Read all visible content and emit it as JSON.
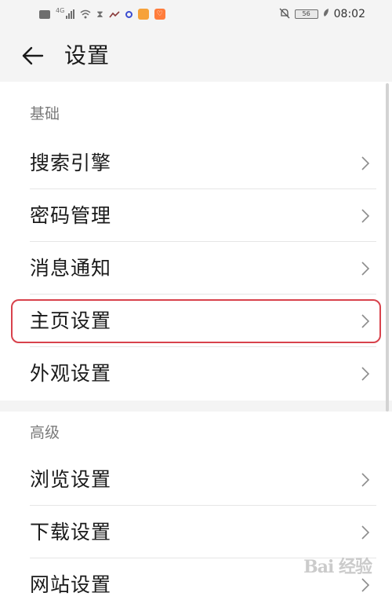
{
  "status_bar": {
    "network": "4G",
    "battery": "56",
    "time": "08:02"
  },
  "toolbar": {
    "title": "设置"
  },
  "sections": [
    {
      "header": "基础",
      "items": [
        {
          "label": "搜索引擎"
        },
        {
          "label": "密码管理"
        },
        {
          "label": "消息通知"
        },
        {
          "label": "主页设置"
        },
        {
          "label": "外观设置"
        }
      ]
    },
    {
      "header": "高级",
      "items": [
        {
          "label": "浏览设置"
        },
        {
          "label": "下载设置"
        },
        {
          "label": "网站设置"
        }
      ]
    }
  ],
  "watermark": "Bai 经验",
  "colors": {
    "highlight": "#d8424c",
    "background": "#f4f4f4"
  }
}
